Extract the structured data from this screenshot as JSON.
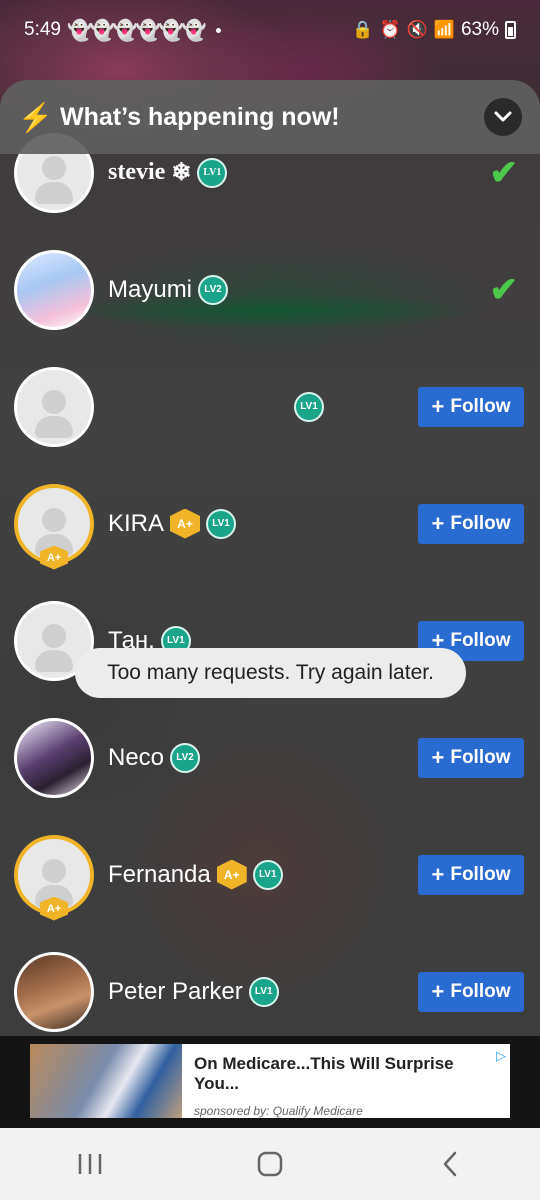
{
  "status_bar": {
    "time": "5:49",
    "notification_icons": [
      "snapchat-ghost-icon",
      "snapchat-ghost-icon",
      "snapchat-ghost-icon",
      "snapchat-ghost-icon",
      "snapchat-ghost-icon",
      "snapchat-ghost-icon"
    ],
    "battery": "63%"
  },
  "panel": {
    "title": "What’s happening now!"
  },
  "users": [
    {
      "name": "stevie",
      "level": "LV1",
      "grade": "",
      "avatar": "default",
      "action": "following"
    },
    {
      "name": "Mayumi",
      "level": "LV2",
      "grade": "",
      "avatar": "anime",
      "action": "following"
    },
    {
      "name": "",
      "level": "LV1",
      "grade": "",
      "avatar": "default",
      "action": "follow"
    },
    {
      "name": "KIRA",
      "level": "LV1",
      "grade": "A+",
      "avatar": "default-gold",
      "action": "follow"
    },
    {
      "name": "Тан.",
      "level": "LV1",
      "grade": "",
      "avatar": "default",
      "action": "follow"
    },
    {
      "name": "Neco",
      "level": "LV2",
      "grade": "",
      "avatar": "neco",
      "action": "follow"
    },
    {
      "name": "Fernanda",
      "level": "LV1",
      "grade": "A+",
      "avatar": "default-gold",
      "action": "follow"
    },
    {
      "name": "Peter Parker",
      "level": "LV1",
      "grade": "",
      "avatar": "peter",
      "action": "follow"
    }
  ],
  "follow_label": "Follow",
  "toast": "Too many requests. Try again later.",
  "ad": {
    "headline": "On Medicare...This Will Surprise You...",
    "sponsor": "sponsored by: Qualify Medicare"
  },
  "colors": {
    "accent_blue": "#2a6bd1",
    "check_green": "#4cc94c",
    "level_teal": "#1aa58a",
    "gold": "#f0b429"
  }
}
